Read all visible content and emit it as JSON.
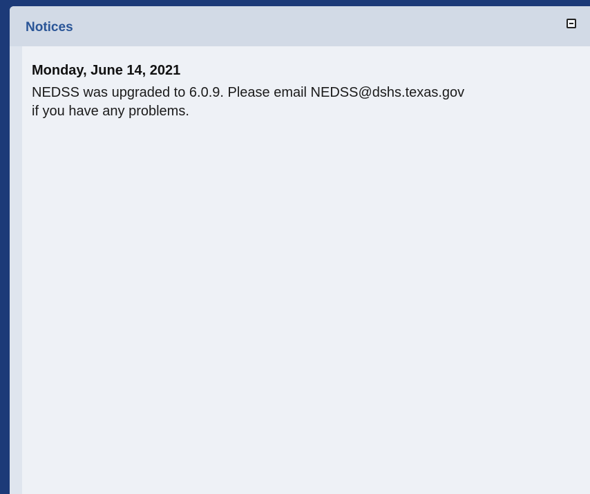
{
  "notices_panel": {
    "title": "Notices",
    "collapse_icon": "minus-square-icon",
    "notice": {
      "date": "Monday, June 14, 2021",
      "message": "NEDSS was upgraded to 6.0.9. Please email NEDSS@dshs.texas.gov if you have any problems."
    }
  },
  "colors": {
    "background": "#1c3a78",
    "header": "#d2dae6",
    "title": "#2a5597",
    "body": "#eef1f6"
  }
}
